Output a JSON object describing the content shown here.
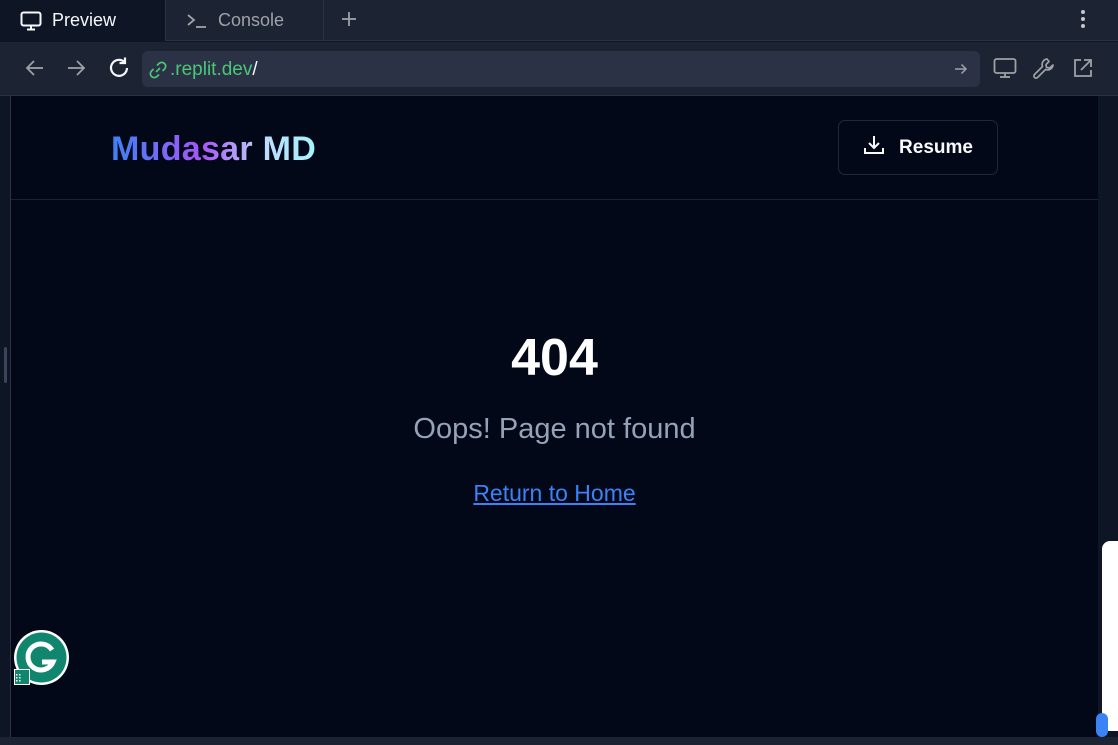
{
  "tabs": [
    {
      "label": "Preview",
      "icon": "monitor-icon",
      "active": true
    },
    {
      "label": "Console",
      "icon": "terminal-icon",
      "active": false
    }
  ],
  "address": {
    "domain": ".replit.dev",
    "path": "/"
  },
  "site": {
    "logo": "Mudasar MD",
    "resume_label": "Resume"
  },
  "not_found": {
    "code": "404",
    "message": "Oops! Page not found",
    "link": "Return to Home"
  },
  "colors": {
    "background": "#020817",
    "chrome": "#1c2333",
    "url_green": "#4ac776",
    "link_blue": "#3b82f6",
    "muted_text": "#94a3b8"
  }
}
